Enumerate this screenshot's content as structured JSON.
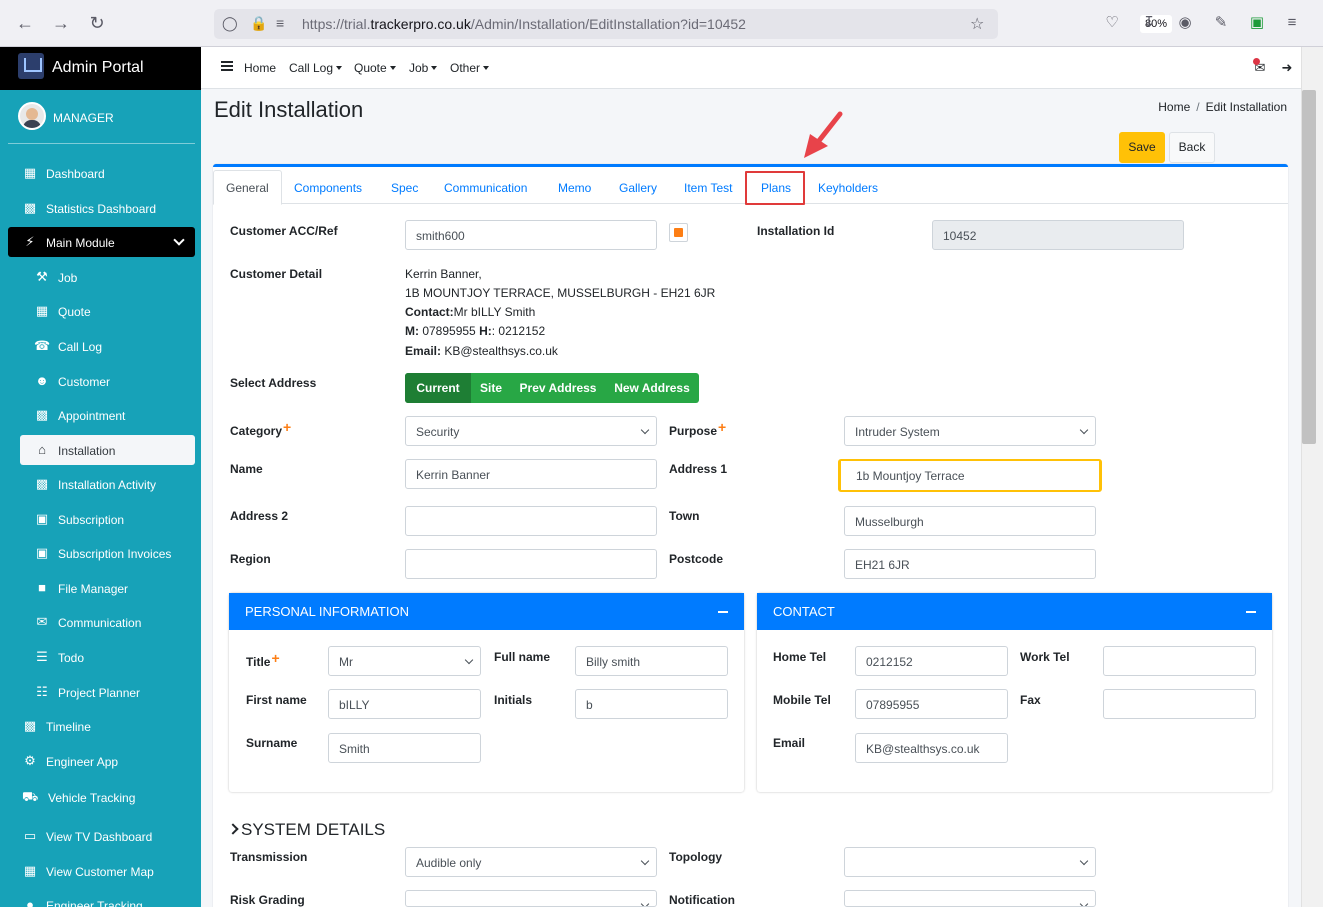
{
  "browser": {
    "url_prefix": "https://trial.",
    "url_domain": "trackerpro.co.uk",
    "url_path": "/Admin/Installation/EditInstallation?id=10452",
    "zoom": "80%"
  },
  "sidebar": {
    "brand": "Admin Portal",
    "user": "MANAGER",
    "items": [
      {
        "label": "Dashboard",
        "icon": "grid-icon"
      },
      {
        "label": "Statistics Dashboard",
        "icon": "chart-icon"
      },
      {
        "label": "Main Module",
        "icon": "plug-icon"
      },
      {
        "label": "Job",
        "icon": "wrench-icon"
      },
      {
        "label": "Quote",
        "icon": "calculator-icon"
      },
      {
        "label": "Call Log",
        "icon": "user-phone-icon"
      },
      {
        "label": "Customer",
        "icon": "users-icon"
      },
      {
        "label": "Appointment",
        "icon": "calendar-icon"
      },
      {
        "label": "Installation",
        "icon": "home-icon"
      },
      {
        "label": "Installation Activity",
        "icon": "chart-icon"
      },
      {
        "label": "Subscription",
        "icon": "file-icon"
      },
      {
        "label": "Subscription Invoices",
        "icon": "file-icon"
      },
      {
        "label": "File Manager",
        "icon": "folder-icon"
      },
      {
        "label": "Communication",
        "icon": "envelope-icon"
      },
      {
        "label": "Todo",
        "icon": "list-icon"
      },
      {
        "label": "Project Planner",
        "icon": "sitemap-icon"
      },
      {
        "label": "Timeline",
        "icon": "calendar-icon"
      },
      {
        "label": "Engineer App",
        "icon": "user-cog-icon"
      },
      {
        "label": "Vehicle Tracking",
        "icon": "vehicle-icon"
      },
      {
        "label": "View TV Dashboard",
        "icon": "tv-icon"
      },
      {
        "label": "View Customer Map",
        "icon": "map-icon"
      },
      {
        "label": "Engineer Tracking",
        "icon": "map-marker-icon"
      }
    ]
  },
  "topnav": {
    "home": "Home",
    "call_log": "Call Log",
    "quote": "Quote",
    "job": "Job",
    "other": "Other"
  },
  "page": {
    "title": "Edit Installation",
    "breadcrumb_home": "Home",
    "breadcrumb_current": "Edit Installation",
    "save": "Save",
    "back": "Back"
  },
  "tabs": [
    "General",
    "Components",
    "Spec",
    "Communication",
    "Memo",
    "Gallery",
    "Item Test",
    "Plans",
    "Keyholders"
  ],
  "general": {
    "customer_ref_label": "Customer ACC/Ref",
    "customer_ref": "smith600",
    "installation_id_label": "Installation Id",
    "installation_id": "10452",
    "customer_detail_label": "Customer Detail",
    "detail_name": "Kerrin Banner,",
    "detail_address": "1B MOUNTJOY TERRACE, MUSSELBURGH - EH21 6JR",
    "contact_label": "Contact:",
    "contact_value": "Mr bILLY Smith",
    "m_label": "M:",
    "m_value": " 07895955 ",
    "h_label": "H:",
    "h_value": ": 0212152",
    "email_label": "Email:",
    "email_value": " KB@stealthsys.co.uk",
    "select_address_label": "Select Address",
    "address_buttons": [
      "Current",
      "Site",
      "Prev Address",
      "New Address"
    ],
    "category_label": "Category",
    "category": "Security",
    "purpose_label": "Purpose",
    "purpose": "Intruder System",
    "name_label": "Name",
    "name": "Kerrin Banner",
    "address1_label": "Address 1",
    "address1": "1b Mountjoy Terrace",
    "address2_label": "Address 2",
    "address2": "",
    "town_label": "Town",
    "town": "Musselburgh",
    "region_label": "Region",
    "region": "",
    "postcode_label": "Postcode",
    "postcode": "EH21 6JR"
  },
  "personal": {
    "header": "PERSONAL INFORMATION",
    "title_label": "Title",
    "title": "Mr",
    "fullname_label": "Full name",
    "fullname": "Billy smith",
    "firstname_label": "First name",
    "firstname": "bILLY",
    "initials_label": "Initials",
    "initials": "b",
    "surname_label": "Surname",
    "surname": "Smith"
  },
  "contact": {
    "header": "CONTACT",
    "home_tel_label": "Home Tel",
    "home_tel": "0212152",
    "work_tel_label": "Work Tel",
    "work_tel": "",
    "mobile_tel_label": "Mobile Tel",
    "mobile_tel": "07895955",
    "fax_label": "Fax",
    "fax": "",
    "email_label": "Email",
    "email": "KB@stealthsys.co.uk"
  },
  "system": {
    "header": "SYSTEM DETAILS",
    "transmission_label": "Transmission",
    "transmission": "Audible only",
    "topology_label": "Topology",
    "topology": "",
    "risk_label": "Risk Grading",
    "risk": "",
    "notification_label": "Notification",
    "notification": ""
  },
  "colors": {
    "sidebar": "#17a2b8",
    "primary": "#007bff",
    "warning": "#ffc107",
    "success": "#28a745",
    "annotation": "#e03a3a"
  }
}
